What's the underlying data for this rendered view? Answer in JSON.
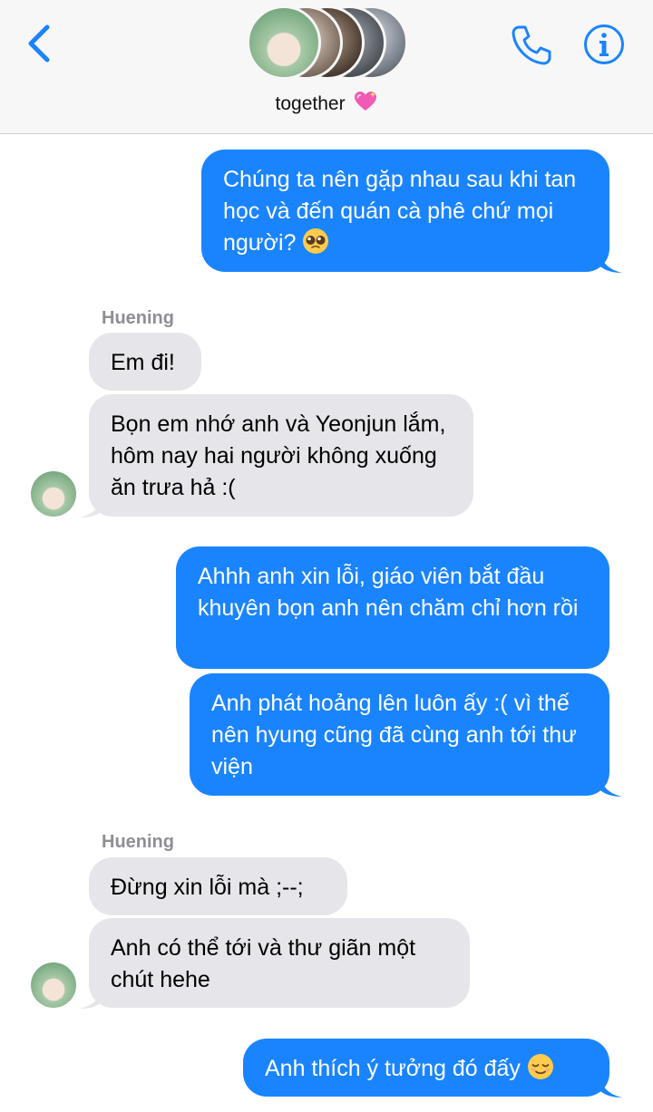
{
  "header": {
    "group_name": "together",
    "heart_emoji": "sparkling-heart",
    "back_icon": "chevron-left-icon",
    "call_icon": "phone-icon",
    "info_icon": "info-icon",
    "accent_color": "#1a84ff"
  },
  "messages": [
    {
      "direction": "outgoing",
      "text": "Chúng ta nên gặp nhau sau khi tan học và đến quán cà phê chứ mọi người?",
      "emoji": "pleading-face"
    },
    {
      "direction": "incoming",
      "sender": "Huening",
      "text": "Em đi!"
    },
    {
      "direction": "incoming",
      "text": "Bọn em nhớ anh và Yeonjun lắm, hôm nay hai người không xuống ăn trưa hả :("
    },
    {
      "direction": "outgoing",
      "text": "Ahhh anh xin lỗi, giáo viên bắt đầu khuyên bọn anh nên chăm chỉ hơn rồi"
    },
    {
      "direction": "outgoing",
      "text": "Anh phát hoảng lên luôn ấy :( vì thế nên hyung cũng đã cùng anh tới thư viện"
    },
    {
      "direction": "incoming",
      "sender": "Huening",
      "text": "Đừng xin lỗi mà ;--;"
    },
    {
      "direction": "incoming",
      "text": "Anh có thể tới và thư giãn một chút hehe"
    },
    {
      "direction": "outgoing",
      "text": "Anh thích ý tưởng đó đấy",
      "emoji": "relieved-face"
    }
  ],
  "colors": {
    "outgoing_bubble": "#1a84ff",
    "incoming_bubble": "#e5e5ea",
    "sender_label": "#8e8e93"
  }
}
